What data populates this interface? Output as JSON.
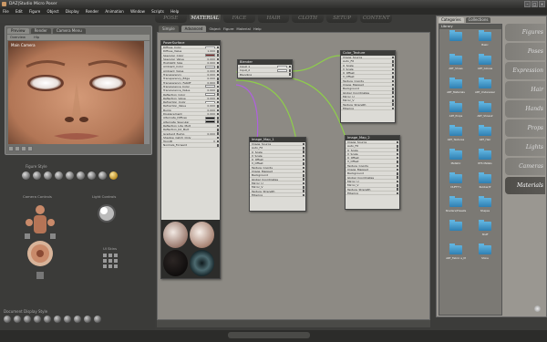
{
  "title_bar": {
    "title": "DAZ|Studio Micro Poser"
  },
  "menu": [
    "File",
    "Edit",
    "Figure",
    "Object",
    "Display",
    "Render",
    "Animation",
    "Window",
    "Scripts",
    "Help"
  ],
  "rooms": [
    {
      "label": "POSE",
      "active": false
    },
    {
      "label": "MATERIAL",
      "active": true
    },
    {
      "label": "FACE",
      "active": false
    },
    {
      "label": "HAIR",
      "active": false
    },
    {
      "label": "CLOTH",
      "active": false
    },
    {
      "label": "SETUP",
      "active": false
    },
    {
      "label": "CONTENT",
      "active": false
    }
  ],
  "preview": {
    "tabs": [
      "Preview",
      "Render"
    ],
    "camera_label": "Camera Menu",
    "viewport_label": "Main Camera",
    "menu_left": "Overview",
    "menu_right": "Hlp"
  },
  "figure_style_label": "Figure Style",
  "controls": {
    "camera_controls": "Camera Controls",
    "light_controls": "Light Controls",
    "ui_skins": "UI Skins"
  },
  "document_display_style": "Document Display Style",
  "material": {
    "tabs": [
      "Simple",
      "Advanced"
    ],
    "header_items": [
      "Object",
      "Figure",
      "Material",
      "Help"
    ]
  },
  "nodes": {
    "poser_surface": {
      "title": "PoserSurface",
      "rows": [
        {
          "label": "Diffuse_Color",
          "kind": "swatch",
          "color": "#ffffff"
        },
        {
          "label": "Diffuse_Value",
          "kind": "value",
          "value": "1.000"
        },
        {
          "label": "Specular_Color",
          "kind": "swatch",
          "color": "#7a2020"
        },
        {
          "label": "Specular_Value",
          "kind": "value",
          "value": "0.000"
        },
        {
          "label": "Highlight_Size",
          "kind": "value",
          "value": "0.000"
        },
        {
          "label": "Ambient_Color",
          "kind": "swatch",
          "color": "#ffffff"
        },
        {
          "label": "Ambient_Value",
          "kind": "value",
          "value": "0.000"
        },
        {
          "label": "Transparency",
          "kind": "value",
          "value": "0.000"
        },
        {
          "label": "Transparency_Edge",
          "kind": "value",
          "value": "0.000"
        },
        {
          "label": "Transparency_Falloff",
          "kind": "value",
          "value": "0.600"
        },
        {
          "label": "Translucence_Color",
          "kind": "swatch",
          "color": "#ffffff"
        },
        {
          "label": "Translucence_Value",
          "kind": "value",
          "value": "0.000"
        },
        {
          "label": "Reflection_Color",
          "kind": "swatch",
          "color": "#ffffff"
        },
        {
          "label": "Reflection_Value",
          "kind": "value",
          "value": "0.000"
        },
        {
          "label": "Refraction_Color",
          "kind": "swatch",
          "color": "#ffffff"
        },
        {
          "label": "Refraction_Value",
          "kind": "value",
          "value": "0.000"
        },
        {
          "label": "Bump",
          "kind": "value",
          "value": "0.000"
        },
        {
          "label": "Displacement",
          "kind": "value",
          "value": "0.000"
        },
        {
          "label": "Alternate_Diffuse",
          "kind": "swatch",
          "color": "#000000"
        },
        {
          "label": "Alternate_Specular",
          "kind": "swatch",
          "color": "#000000"
        },
        {
          "label": "Reflection_Lite_Mult",
          "kind": "value",
          "value": ""
        },
        {
          "label": "Reflection_Kd_Mult",
          "kind": "value",
          "value": ""
        },
        {
          "label": "Gradient_Bump",
          "kind": "value",
          "value": "0.000"
        },
        {
          "label": "Shadow_Catch_Only",
          "kind": "value",
          "value": ""
        },
        {
          "label": "ToonID",
          "kind": "value",
          "value": "0"
        },
        {
          "label": "Normals_Forward",
          "kind": "value",
          "value": ""
        }
      ]
    },
    "blender": {
      "title": "Blender",
      "rows": [
        {
          "label": "Input_1"
        },
        {
          "label": "Input_2"
        },
        {
          "label": "Blending"
        }
      ]
    },
    "color_texture": {
      "title": "Color_Texture",
      "rows": [
        "Image_Source",
        "Auto_Fit",
        "U_Scale",
        "V_Scale",
        "U_Offset",
        "V_Offset",
        "Texture_Coords",
        "Image_Mapped",
        "Background",
        "Global_Coordinates",
        "Mirror_U",
        "Mirror_V",
        "Texture_Strength",
        "Filtering"
      ]
    },
    "image_map_1": {
      "title": "Image_Map_1",
      "rows": [
        "Image_Source",
        "Auto_Fit",
        "U_Scale",
        "V_Scale",
        "U_Offset",
        "V_Offset",
        "Texture_Coords",
        "Image_Mapped",
        "Background",
        "Global_Coordinates",
        "Mirror_U",
        "Mirror_V",
        "Texture_Strength",
        "Filtering"
      ]
    },
    "image_map_2": {
      "title": "Image_Map_2",
      "rows": [
        "Image_Source",
        "Auto_Fit",
        "U_Scale",
        "V_Scale",
        "U_Offset",
        "V_Offset",
        "Texture_Coords",
        "Image_Mapped",
        "Background",
        "Global_Coordinates",
        "Mirror_U",
        "Mirror_V",
        "Texture_Strength",
        "Filtering"
      ]
    }
  },
  "library": {
    "tabs": [
      "Categories",
      "Collections"
    ],
    "header": "Library",
    "folders": [
      "",
      "Basic",
      "ART_Shoes",
      "ART_Gloves",
      "ART_Materials",
      "ART_Underwear",
      "ART_Props",
      "ART_Shoes2",
      "ART_Textures",
      "ART_Hair",
      "Metallic",
      "RTS Metals",
      "DUFFY's",
      "Rubber/P",
      "Shaders/Presets",
      "Shapes",
      "",
      "Stuff",
      "ART_Fabric a_M",
      "Shine"
    ],
    "categories": [
      {
        "label": "Figures",
        "active": false
      },
      {
        "label": "Poses",
        "active": false
      },
      {
        "label": "Expression",
        "active": false
      },
      {
        "label": "Hair",
        "active": false
      },
      {
        "label": "Hands",
        "active": false
      },
      {
        "label": "Props",
        "active": false
      },
      {
        "label": "Lights",
        "active": false
      },
      {
        "label": "Cameras",
        "active": false
      },
      {
        "label": "Materials",
        "active": true
      }
    ]
  },
  "colors": {
    "wire_green": "#8ecf4a",
    "wire_purple": "#b060e0",
    "folder_blue": "#3a8fc8"
  }
}
